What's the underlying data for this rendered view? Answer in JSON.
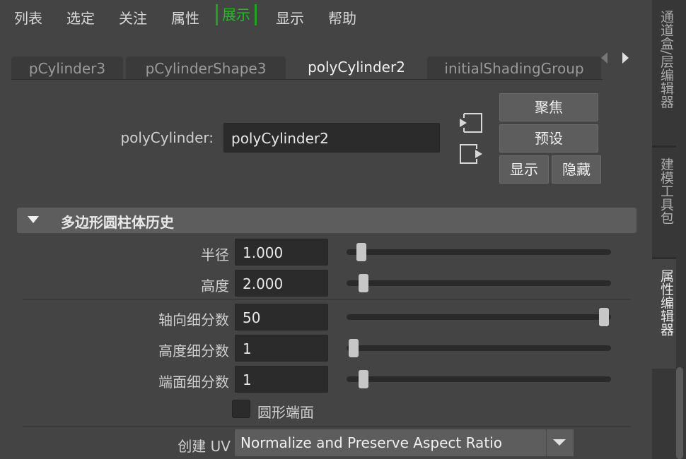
{
  "menu": {
    "items": [
      "列表",
      "选定",
      "关注",
      "属性",
      "展示",
      "显示",
      "帮助"
    ],
    "active_index": 4,
    "active_color": "#1fbf1f"
  },
  "dock": {
    "tabs": [
      "通道盒/层编辑器",
      "建模工具包",
      "属性编辑器"
    ],
    "active_index": 2
  },
  "tabs": {
    "items": [
      "pCylinder3",
      "pCylinderShape3",
      "polyCylinder2",
      "initialShadingGroup"
    ],
    "active_index": 2
  },
  "node": {
    "label": "polyCylinder:",
    "value": "polyCylinder2",
    "buttons": {
      "focus": "聚焦",
      "presets": "预设",
      "show": "显示",
      "hide": "隐藏"
    },
    "icons": [
      "input-connection-icon",
      "output-connection-icon"
    ]
  },
  "section": {
    "title": "多边形圆柱体历史",
    "fields": [
      {
        "label": "半径",
        "value": "1.000",
        "slider_fraction": 0.03
      },
      {
        "label": "高度",
        "value": "2.000",
        "slider_fraction": 0.04
      },
      {
        "label": "轴向细分数",
        "value": "50",
        "slider_fraction": 1.0
      },
      {
        "label": "高度细分数",
        "value": "1",
        "slider_fraction": 0.0
      },
      {
        "label": "端面细分数",
        "value": "1",
        "slider_fraction": 0.04
      }
    ],
    "round_cap": {
      "label": "圆形端面",
      "checked": false
    },
    "create_uv": {
      "label": "创建 UV",
      "value": "Normalize and Preserve Aspect Ratio"
    }
  }
}
